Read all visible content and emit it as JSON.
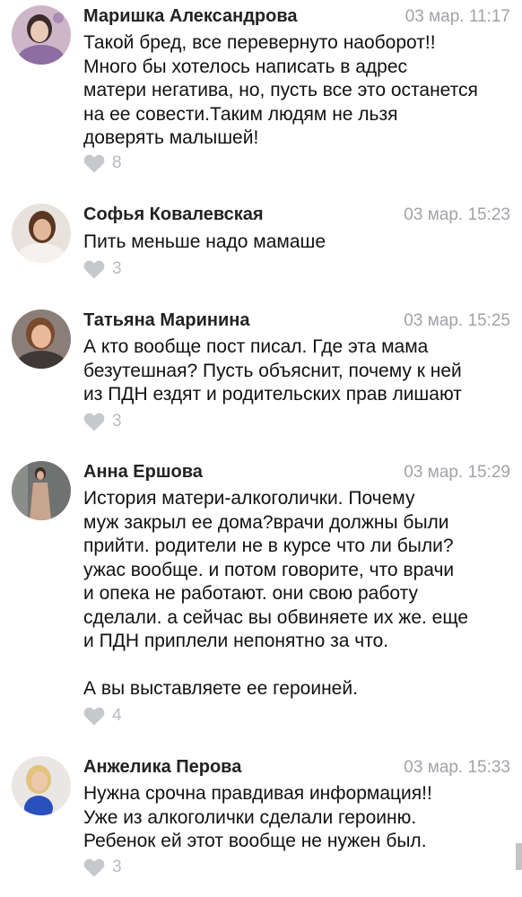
{
  "comments": [
    {
      "author": "Маришка Александрова",
      "time": "03 мар. 11:17",
      "lines": [
        "Такой бред, все перевернуто наоборот!!",
        "Много бы хотелось написать в адрес",
        "матери негатива, но, пусть все это останется",
        "на ее совести.Таким людям не льзя",
        "доверять малышей!"
      ],
      "likes": "8",
      "avatar_palette": {
        "bg": "#cdb6c8",
        "face": "#e9c9b8",
        "hair": "#3a2a2a",
        "cloth": "#8e6da3"
      }
    },
    {
      "author": "Софья Ковалевская",
      "time": "03 мар. 15:23",
      "lines": [
        "Пить меньше надо мамаше"
      ],
      "likes": "3",
      "avatar_palette": {
        "bg": "#e8e2dc",
        "face": "#e2b89c",
        "hair": "#5a3520",
        "cloth": "#f4f1ee"
      }
    },
    {
      "author": "Татьяна Маринина",
      "time": "03 мар. 15:25",
      "lines": [
        "А кто вообще пост писал. Где эта мама",
        "безутешная? Пусть объяснит, почему к ней",
        "из ПДН ездят и родительских прав лишают"
      ],
      "likes": "3",
      "avatar_palette": {
        "bg": "#8b7e78",
        "face": "#e8b99c",
        "hair": "#7a4a2e",
        "cloth": "#3e3838"
      }
    },
    {
      "author": "Анна Ершова",
      "time": "03 мар. 15:29",
      "lines": [
        "История матери-алкоголички. Почему",
        "муж закрыл ее дома?врачи должны были",
        "прийти. родители не в курсе что ли были?",
        "ужас вообще. и потом говорите, что врачи",
        "и опека не работают. они свою работу",
        "сделали. а сейчас вы обвиняете их же. еще",
        "и ПДН приплели непонятно за что.",
        "",
        "А вы выставляете ее героиней."
      ],
      "likes": "4",
      "avatar_palette": {
        "bg": "#6f7270",
        "face": "#d9b09a",
        "hair": "#3c2c22",
        "cloth": "#c9a58e"
      }
    },
    {
      "author": "Анжелика Перова",
      "time": "03 мар. 15:33",
      "lines": [
        "Нужна срочна правдивая информация!!",
        "Уже из алкоголички сделали героиню.",
        "Ребенок ей этот вообще не нужен был."
      ],
      "likes": "3",
      "avatar_palette": {
        "bg": "#e9e6e4",
        "face": "#edc8ad",
        "hair": "#e3c27a",
        "cloth": "#2a4fbf"
      }
    }
  ],
  "colors": {
    "author": "#222222",
    "time": "#a0a3a8",
    "heart": "#c6c8cc",
    "like_count": "#b8bbc0"
  }
}
